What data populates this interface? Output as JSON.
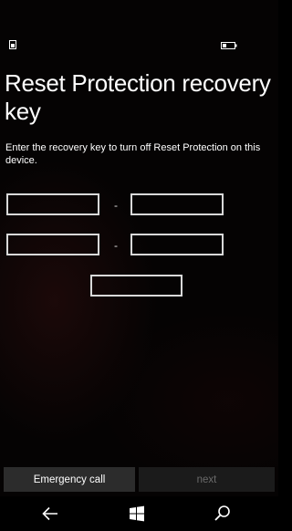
{
  "status_bar": {
    "left_icon": "notification-icon",
    "right_icon": "battery-icon"
  },
  "page": {
    "title": "Reset Protection recovery key",
    "instructions": "Enter the recovery key to turn off Reset Protection on this device."
  },
  "recovery_key": {
    "separator": "-",
    "fields": [
      {
        "value": "",
        "placeholder": ""
      },
      {
        "value": "",
        "placeholder": ""
      },
      {
        "value": "",
        "placeholder": ""
      },
      {
        "value": "",
        "placeholder": ""
      },
      {
        "value": "",
        "placeholder": ""
      }
    ]
  },
  "buttons": {
    "emergency_label": "Emergency call",
    "next_label": "next"
  },
  "nav_bar": {
    "back_icon": "back-arrow-icon",
    "start_icon": "windows-logo-icon",
    "search_icon": "search-icon"
  },
  "colors": {
    "background": "#000000",
    "text": "#ffffff",
    "field_border": "#d9d9d9",
    "emergency_button": "#2c2c2c",
    "next_button_disabled": "#1b1b1b",
    "next_text_disabled": "#6a6a6a"
  }
}
